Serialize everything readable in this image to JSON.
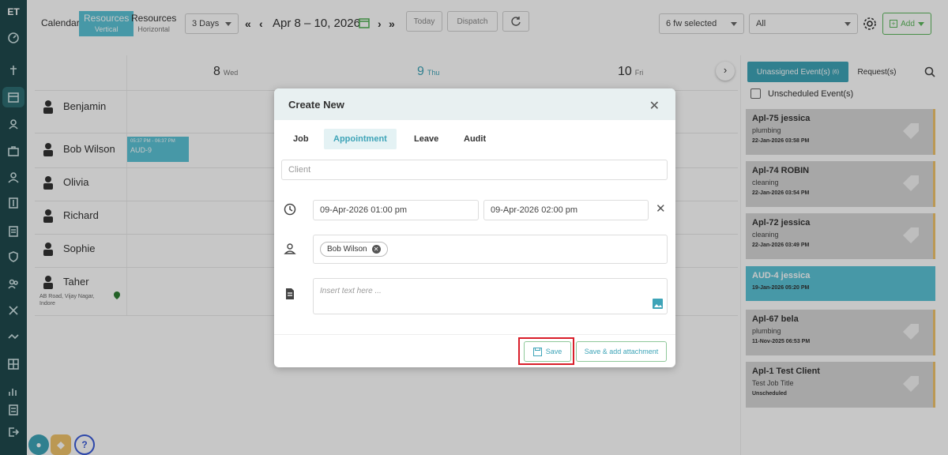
{
  "rail": {
    "logo": "ET"
  },
  "topbar": {
    "views": [
      {
        "label": "Calendar",
        "sub": ""
      },
      {
        "label": "Resources",
        "sub": "Vertical"
      },
      {
        "label": "Resources",
        "sub": "Horizontal"
      }
    ],
    "range_select": "3 Days",
    "date_range": "Apr 8 – 10, 2026",
    "today_label": "Today",
    "dispatch_label": "Dispatch",
    "fw_selected": "6 fw selected",
    "filter_all": "All",
    "add_label": "Add"
  },
  "schedule": {
    "days": [
      {
        "num": "8",
        "dow": "Wed"
      },
      {
        "num": "9",
        "dow": "Thu"
      },
      {
        "num": "10",
        "dow": "Fri"
      }
    ],
    "resources": [
      {
        "name": "Benjamin",
        "address": ""
      },
      {
        "name": "Bob Wilson",
        "address": ""
      },
      {
        "name": "Olivia",
        "address": ""
      },
      {
        "name": "Richard",
        "address": ""
      },
      {
        "name": "Sophie",
        "address": ""
      },
      {
        "name": "Taher",
        "address": "AB Road, Vijay Nagar, Indore"
      }
    ],
    "event": {
      "time": "05:37 PM - 06:37 PM",
      "title": "AUD-9"
    }
  },
  "panel": {
    "tab_unassigned": "Unassigned Event(s)",
    "tab_unassigned_count": "(6)",
    "tab_requests": "Request(s)",
    "unscheduled_label": "Unscheduled Event(s)",
    "cards": [
      {
        "title": "Apl-75 jessica",
        "sub": "plumbing",
        "date": "22-Jan-2026 03:58 PM"
      },
      {
        "title": "Apl-74 ROBIN",
        "sub": "cleaning",
        "date": "22-Jan-2026 03:54 PM"
      },
      {
        "title": "Apl-72 jessica",
        "sub": "cleaning",
        "date": "22-Jan-2026 03:49 PM"
      },
      {
        "title": "AUD-4 jessica",
        "sub": "",
        "date": "19-Jan-2026 05:20 PM"
      },
      {
        "title": "Apl-67 bela",
        "sub": "plumbing",
        "date": "11-Nov-2025 06:53 PM"
      },
      {
        "title": "Apl-1 Test Client",
        "sub": "Test Job Title",
        "date": "Unscheduled"
      }
    ]
  },
  "modal": {
    "title": "Create New",
    "tabs": [
      "Job",
      "Appointment",
      "Leave",
      "Audit"
    ],
    "client_placeholder": "Client",
    "start": "09-Apr-2026 01:00 pm",
    "end": "09-Apr-2026 02:00 pm",
    "assignee": "Bob Wilson",
    "notes_placeholder": "Insert text here ...",
    "save_label": "Save",
    "save_attach_label": "Save & add attachment"
  },
  "colors": {
    "rail": "#1f4a4e",
    "accent": "#5bc3d6",
    "highlight": "#d91e2a"
  }
}
